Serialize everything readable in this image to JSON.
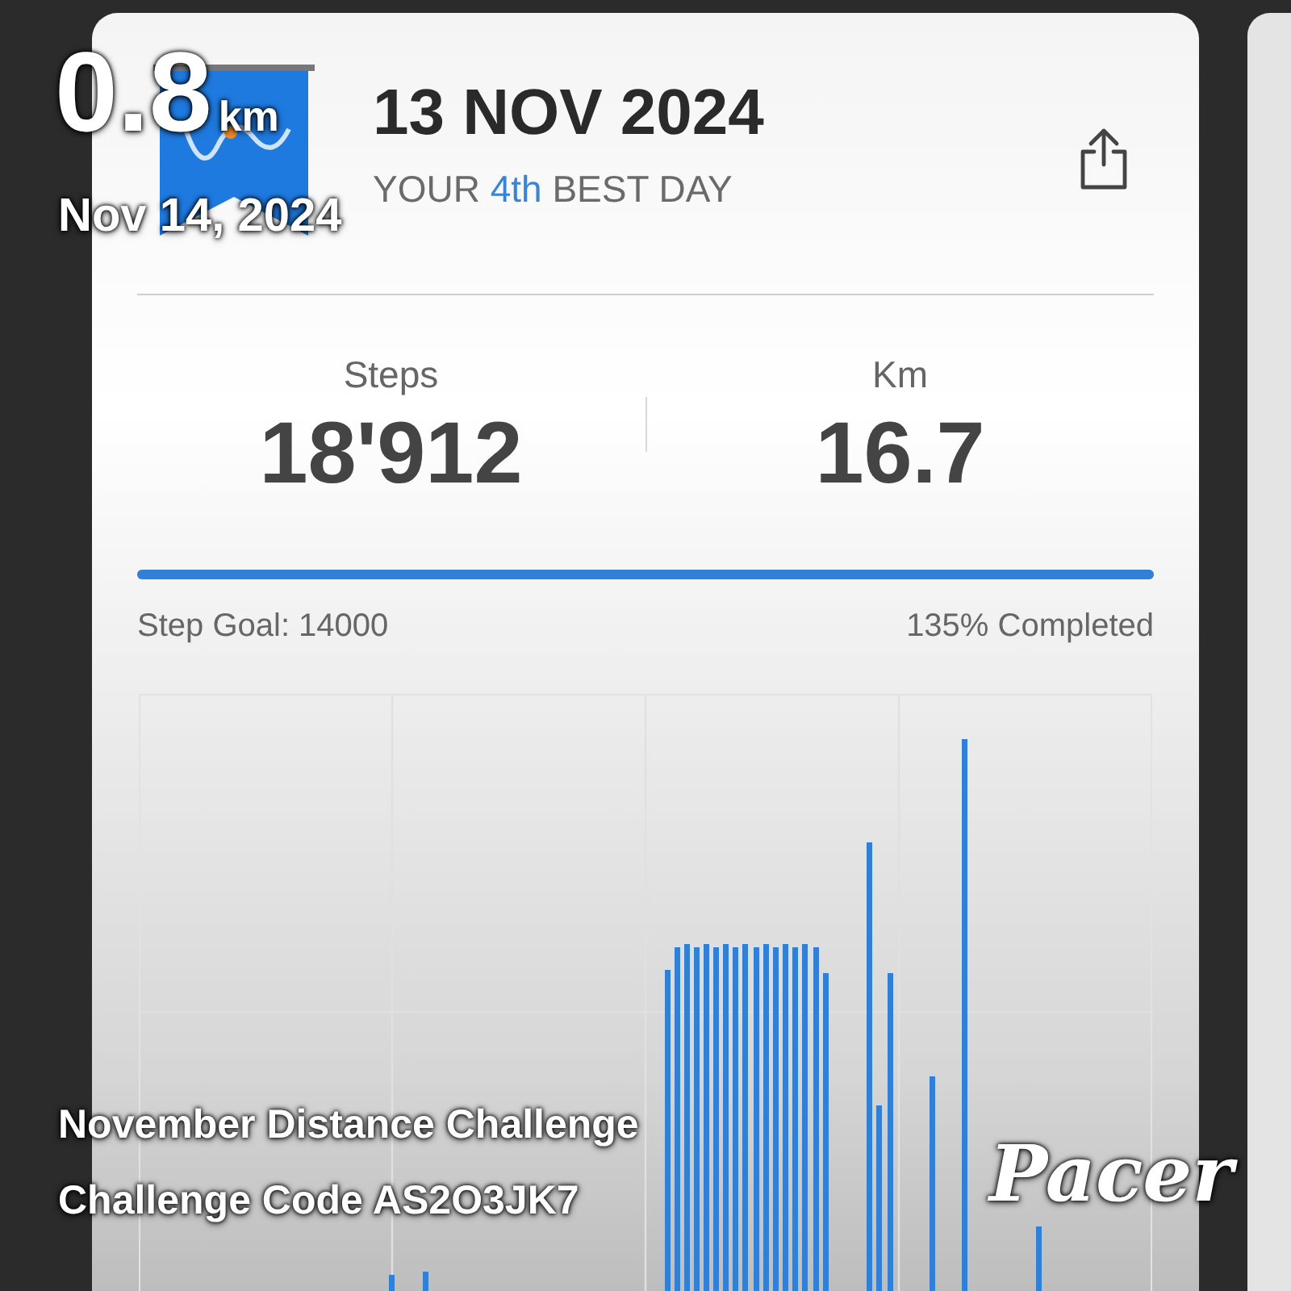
{
  "card": {
    "title": "13 NOV 2024",
    "subtitle": {
      "before": "YOUR",
      "rank": "4th",
      "after": "BEST DAY"
    },
    "stats": [
      {
        "label": "Steps",
        "value": "18'912"
      },
      {
        "label": "Km",
        "value": "16.7"
      }
    ],
    "goal": {
      "level": 1,
      "label": "Step Goal: 14000",
      "completed": "135% Completed"
    }
  },
  "overlay": {
    "distance": "0.8",
    "unit": "km",
    "date": "Nov 14, 2024",
    "challenge": "November Distance Challenge",
    "code": "Challenge Code AS2O3JK7",
    "brand": "Pacer"
  }
}
